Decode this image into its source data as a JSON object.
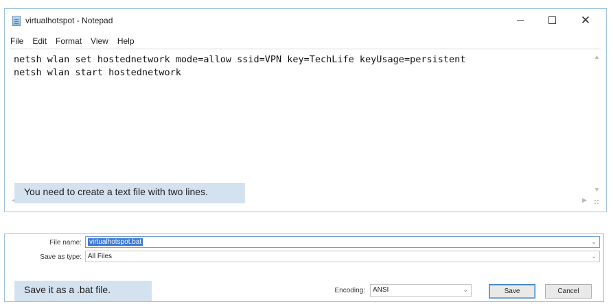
{
  "notepad": {
    "title": "virtualhotspot - Notepad",
    "menu": [
      "File",
      "Edit",
      "Format",
      "View",
      "Help"
    ],
    "lines": [
      "netsh wlan set hostednetwork mode=allow ssid=VPN key=TechLife keyUsage=persistent",
      "netsh wlan start hostednetwork"
    ],
    "window_controls": {
      "minimize": "minimize-icon",
      "maximize": "maximize-icon",
      "close": "close-icon",
      "close_glyph": "✕"
    }
  },
  "captions": {
    "text_file": "You need to create a text file with two lines.",
    "bat_file": "Save it as a .bat file."
  },
  "save_dialog": {
    "file_name_label": "File name:",
    "file_name_value": "virtualhotspot.bat",
    "save_type_label": "Save as type:",
    "save_type_value": "All Files",
    "encoding_label": "Encoding:",
    "encoding_value": "ANSI",
    "save_button": "Save",
    "cancel_button": "Cancel"
  },
  "colors": {
    "caption_background": "#d4e2ef",
    "selection": "#3a78d4",
    "window_border": "#9fc3e0"
  }
}
